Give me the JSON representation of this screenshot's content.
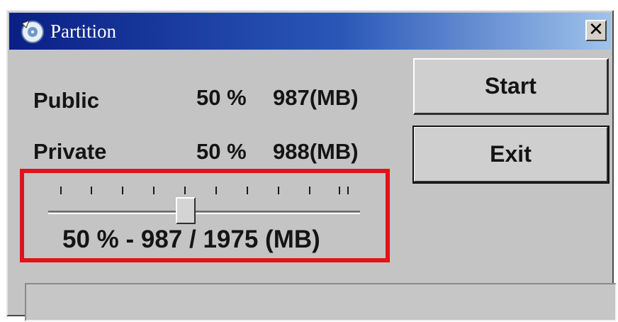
{
  "window": {
    "title": "Partition",
    "close_glyph": "✕",
    "icon": "partition-disk-icon"
  },
  "partitions": [
    {
      "label": "Public",
      "percent_text": "50 %",
      "size_text": "987(MB)"
    },
    {
      "label": "Private",
      "percent_text": "50 %",
      "size_text": "988(MB)"
    }
  ],
  "buttons": {
    "start_label": "Start",
    "exit_label": "Exit"
  },
  "slider": {
    "value_percent": 50,
    "tick_count": 11,
    "readout": "50 % - 987 / 1975 (MB)"
  },
  "statusbar": {
    "text": ""
  },
  "colors": {
    "highlight": "#e01418",
    "titlebar_start": "#0a1f86",
    "titlebar_end": "#9fc3ea",
    "face": "#c4c4c4"
  }
}
